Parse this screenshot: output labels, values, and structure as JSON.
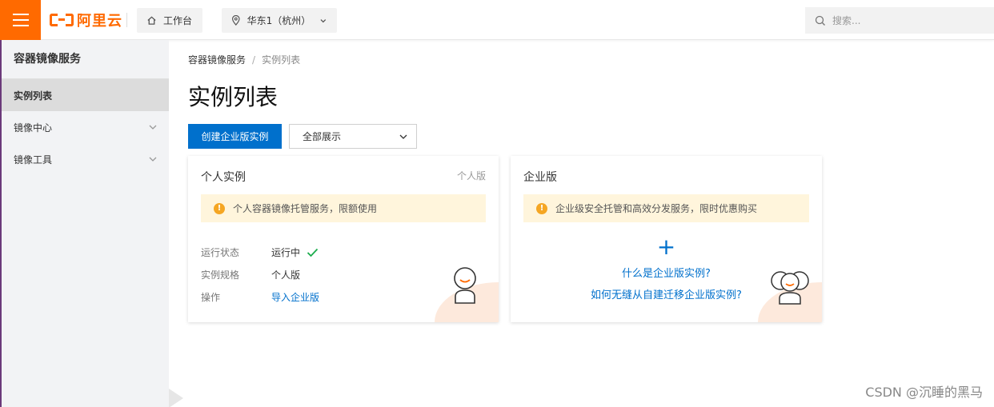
{
  "topbar": {
    "brand": "阿里云",
    "workbench_label": "工作台",
    "region_label": "华东1（杭州）",
    "search_placeholder": "搜索..."
  },
  "sidebar": {
    "title": "容器镜像服务",
    "items": [
      {
        "label": "实例列表",
        "active": true
      },
      {
        "label": "镜像中心",
        "expandable": true
      },
      {
        "label": "镜像工具",
        "expandable": true
      }
    ]
  },
  "main": {
    "breadcrumb": [
      "容器镜像服务",
      "实例列表"
    ],
    "breadcrumb_sep": "/",
    "title": "实例列表",
    "create_button": "创建企业版实例",
    "filter_select": "全部展示"
  },
  "cards": {
    "personal": {
      "title": "个人实例",
      "tag": "个人版",
      "notice": "个人容器镜像托管服务，限额使用",
      "rows": [
        {
          "key": "运行状态",
          "value": "运行中",
          "status": "ok"
        },
        {
          "key": "实例规格",
          "value": "个人版"
        },
        {
          "key": "操作",
          "value": "导入企业版",
          "link": true
        }
      ]
    },
    "enterprise": {
      "title": "企业版",
      "notice": "企业级安全托管和高效分发服务，限时优惠购买",
      "plus": "+",
      "link1": "什么是企业版实例?",
      "link2": "如何无缝从自建迁移企业版实例?"
    }
  },
  "watermark": "CSDN @沉睡的黑马",
  "colors": {
    "brand_orange": "#ff6a00",
    "primary_blue": "#0070cc",
    "notice_bg": "#fff5dc",
    "success_green": "#1aac4c"
  }
}
